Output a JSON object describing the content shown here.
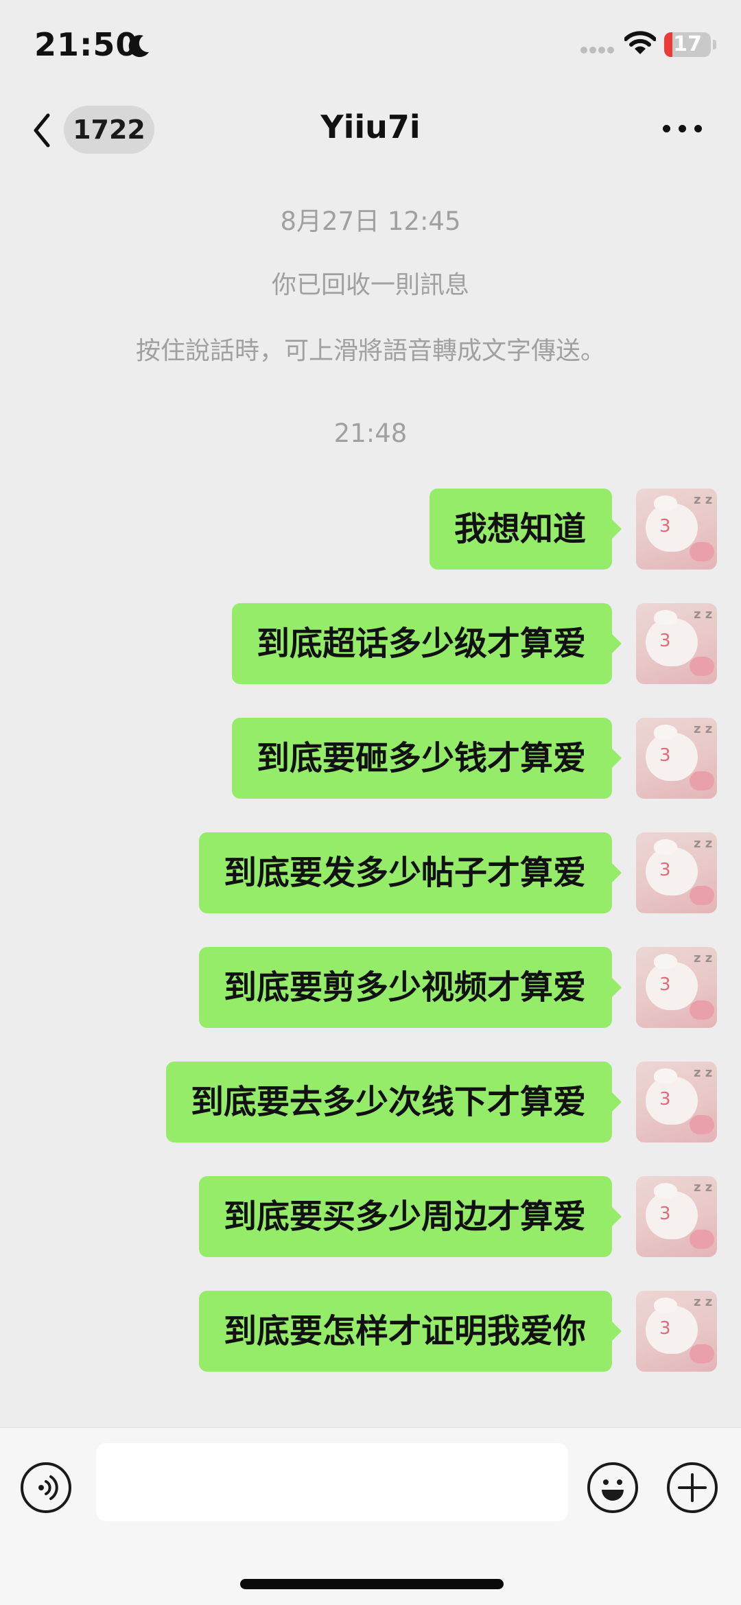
{
  "status_bar": {
    "time": "21:50",
    "battery": "17",
    "battery_level": 0.17
  },
  "nav": {
    "unread_count": "1722",
    "title": "Yiiu7i"
  },
  "system_messages": {
    "timestamp_1": "8月27日 12:45",
    "recalled": "你已回收一則訊息",
    "voice_tip": "按住說話時，可上滑將語音轉成文字傳送。",
    "timestamp_2": "21:48"
  },
  "messages": [
    {
      "text": "我想知道"
    },
    {
      "text": "到底超话多少级才算爱"
    },
    {
      "text": "到底要砸多少钱才算爱"
    },
    {
      "text": "到底要发多少帖子才算爱"
    },
    {
      "text": "到底要剪多少视频才算爱"
    },
    {
      "text": "到底要去多少次线下才算爱"
    },
    {
      "text": "到底要买多少周边才算爱"
    },
    {
      "text": "到底要怎样才证明我爱你"
    }
  ],
  "avatar": {
    "number": "3",
    "sleep_mark": "z z"
  },
  "input_bar": {
    "placeholder": ""
  },
  "colors": {
    "bubble": "#95ec69",
    "background": "#ededed",
    "battery_low": "#ea3a3a"
  },
  "icons": [
    "moon-icon",
    "signal-icon",
    "wifi-icon",
    "battery-icon",
    "back-chevron-icon",
    "more-dots-icon",
    "voice-icon",
    "emoji-icon",
    "plus-icon"
  ]
}
